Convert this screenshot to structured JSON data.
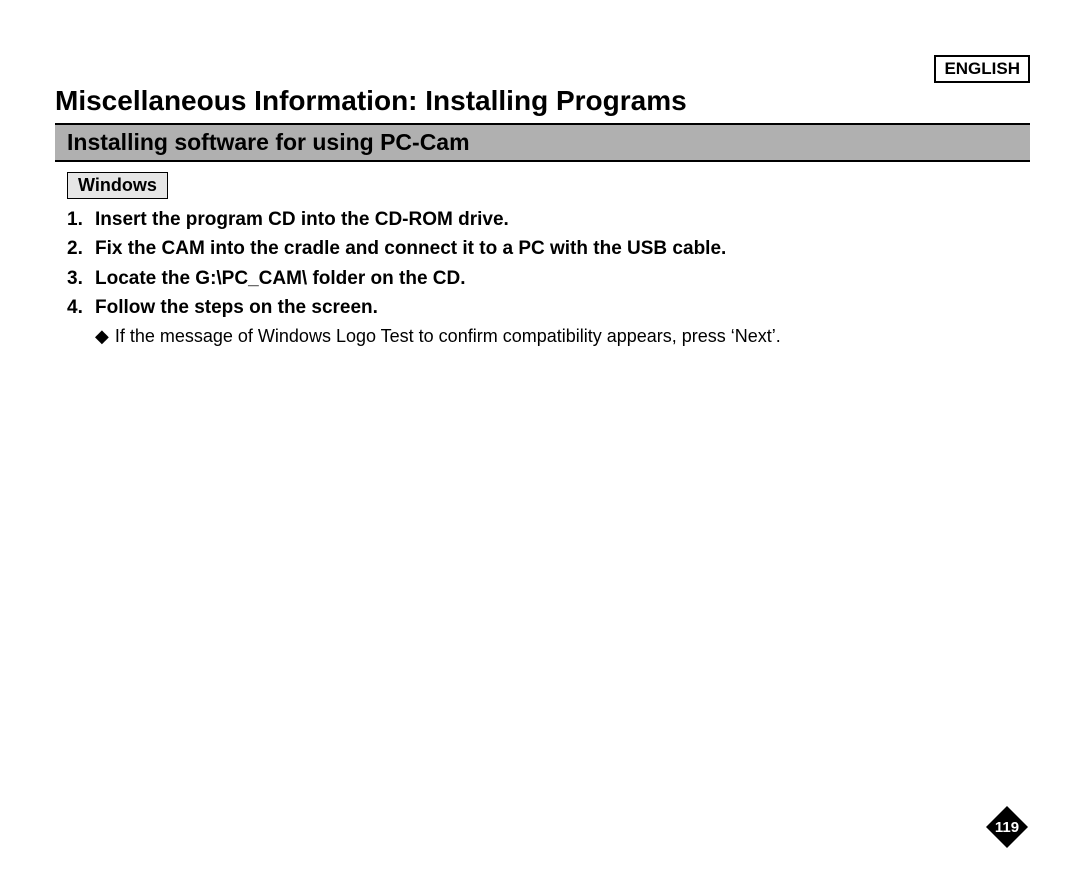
{
  "language_label": "ENGLISH",
  "page_title": "Miscellaneous Information: Installing Programs",
  "section_heading": "Installing software for using PC-Cam",
  "os_tag": "Windows",
  "steps": [
    {
      "num": "1.",
      "text": "Insert the program CD into the CD-ROM drive."
    },
    {
      "num": "2.",
      "text": "Fix the CAM into the cradle and connect it to a PC with the USB cable."
    },
    {
      "num": "3.",
      "text": "Locate the G:\\PC_CAM\\ folder on the CD."
    },
    {
      "num": "4.",
      "text": "Follow the steps on the screen."
    }
  ],
  "sub_note": {
    "bullet": "◆",
    "text": "If the message of Windows Logo Test to confirm compatibility appears, press ‘Next’."
  },
  "page_number": "119"
}
